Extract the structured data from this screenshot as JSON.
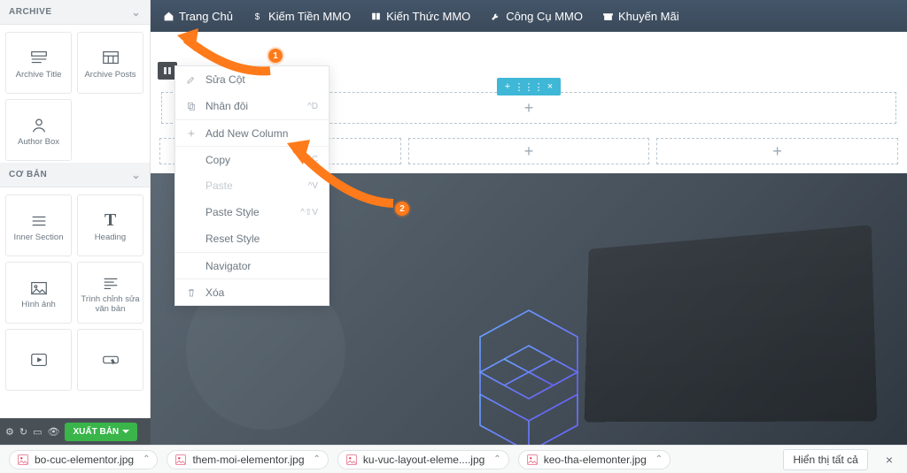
{
  "sidebar": {
    "panels": [
      {
        "title": "ARCHIVE",
        "widgets": [
          {
            "name": "widget-archive-title",
            "icon": "title",
            "label": "Archive Title"
          },
          {
            "name": "widget-archive-posts",
            "icon": "grid",
            "label": "Archive Posts"
          },
          {
            "name": "widget-author-box",
            "icon": "user",
            "label": "Author Box"
          }
        ]
      },
      {
        "title": "CƠ BẢN",
        "widgets": [
          {
            "name": "widget-inner-section",
            "icon": "lines",
            "label": "Inner Section"
          },
          {
            "name": "widget-heading",
            "icon": "T",
            "label": "Heading"
          },
          {
            "name": "widget-image",
            "icon": "img",
            "label": "Hình ảnh"
          },
          {
            "name": "widget-text-editor",
            "icon": "textedit",
            "label": "Trình chỉnh sửa văn bản"
          },
          {
            "name": "widget-video",
            "icon": "play",
            "label": ""
          },
          {
            "name": "widget-button",
            "icon": "btn",
            "label": ""
          }
        ]
      }
    ],
    "publish": "XUẤT BẢN"
  },
  "nav": [
    {
      "name": "nav-home",
      "icon": "home",
      "label": "Trang Chủ"
    },
    {
      "name": "nav-mmo-money",
      "icon": "dollar",
      "label": "Kiếm Tiền MMO"
    },
    {
      "name": "nav-mmo-knowledge",
      "icon": "book",
      "label": "Kiến Thức MMO"
    },
    {
      "name": "nav-mmo-tools",
      "icon": "wrench",
      "label": "Công Cụ MMO"
    },
    {
      "name": "nav-promo",
      "icon": "gift",
      "label": "Khuyến Mãi"
    }
  ],
  "context_menu": {
    "items": [
      {
        "name": "ctx-edit-column",
        "icon": "pencil",
        "label": "Sửa Cột"
      },
      {
        "name": "ctx-duplicate",
        "icon": "copy",
        "label": "Nhân đôi",
        "shortcut": "^D"
      },
      {
        "name": "ctx-add-column",
        "icon": "plus",
        "label": "Add New Column",
        "sep": true
      },
      {
        "name": "ctx-copy",
        "icon": "",
        "label": "Copy",
        "shortcut": "^C",
        "sep": true
      },
      {
        "name": "ctx-paste",
        "icon": "",
        "label": "Paste",
        "shortcut": "^V",
        "disabled": true
      },
      {
        "name": "ctx-paste-style",
        "icon": "",
        "label": "Paste Style",
        "shortcut": "^⇧V"
      },
      {
        "name": "ctx-reset-style",
        "icon": "",
        "label": "Reset Style"
      },
      {
        "name": "ctx-navigator",
        "icon": "",
        "label": "Navigator",
        "sep": true
      },
      {
        "name": "ctx-delete",
        "icon": "trash",
        "label": "Xóa",
        "sep": true
      }
    ]
  },
  "callouts": {
    "one": "1",
    "two": "2"
  },
  "downloads": [
    {
      "name": "dl-bo-cuc",
      "label": "bo-cuc-elementor.jpg"
    },
    {
      "name": "dl-them-moi",
      "label": "them-moi-elementor.jpg"
    },
    {
      "name": "dl-ku-vuc",
      "label": "ku-vuc-layout-eleme....jpg"
    },
    {
      "name": "dl-keo-tha",
      "label": "keo-tha-elemonter.jpg"
    }
  ],
  "showall": "Hiển thị tất cả"
}
